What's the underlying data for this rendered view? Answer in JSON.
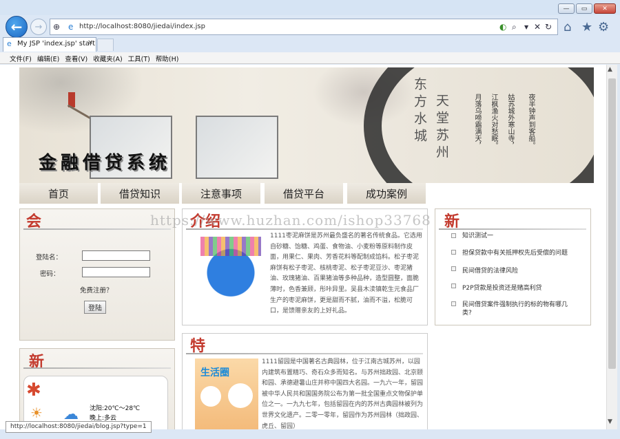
{
  "browser": {
    "url": "http://localhost:8080/jiedai/index.jsp",
    "tab_title": "My JSP 'index.jsp' startin...",
    "status_url": "http://localhost:8080/jiedai/blog.jsp?type=1",
    "menu": [
      "文件(F)",
      "编辑(E)",
      "查看(V)",
      "收藏夹(A)",
      "工具(T)",
      "帮助(H)"
    ]
  },
  "banner": {
    "logo": "金融借贷系统",
    "title_right": "天堂苏州",
    "title_left": "东方水城",
    "poem": [
      "夜半钟声到客船。",
      "姑苏城外寒山寺，",
      "江枫渔火对愁眠。",
      "月落乌啼霜满天，"
    ]
  },
  "nav": [
    "首页",
    "借贷知识",
    "注意事项",
    "借贷平台",
    "成功案例"
  ],
  "login": {
    "heading": "会",
    "username_label": "登陆名：",
    "password_label": "密码：",
    "register": "免费注册？",
    "submit": "登陆"
  },
  "weather_panel": {
    "heading": "新",
    "line1": "沈阳:20℃～28℃",
    "line2": "晚上:多云"
  },
  "watermark": "https://www.huzhan.com/ishop33768",
  "article1": {
    "heading": "介绍",
    "text": "1111枣泥麻饼是苏州最负盛名的著名传统食品。它选用自砂糖、饴糖、鸡蛋、食物油、小麦粉等原料制作皮面，用果仁、果肉、芳香花料等配制成馅料。松子枣泥麻饼有松子枣泥、核桃枣泥、松子枣泥豆沙、枣泥猪油、玫瑰猪油、百果猪油等多种品种，造型圆整，面脆薄时，色香兼顾，彤咔异里。吴县木渎镇乾生元食品厂生产的枣泥麻饼，更是甜而不腻，油而不溢，松脆可口，是馈赠亲友的上好礼品。"
  },
  "article2": {
    "heading": "特",
    "text": "1111留园是中国著名古典园林，位于江南古城苏州，以园内建筑布置精巧、奇石众多而知名。与苏州拙政园、北京颐和园、承德避暑山庄并称中国四大名园。一九六一年，留园被中华人民共和国国务院公布为第一批全国重点文物保护单位之一。一九九七年，包括留园在内的苏州古典园林被列为世界文化遗产。二零一零年，留园作为苏州园林（拙政园、虎丘、留园）"
  },
  "news": {
    "heading": "新",
    "items": [
      "知识测试一",
      "担保贷款中有关抵押权先后受偿的问题",
      "民间借贷的法律风险",
      "P2P贷款是投资还是赌高利贷",
      "民间借贷案件强制执行的标的物有哪几类?"
    ]
  },
  "colors": {
    "accent_red": "#c33a2e",
    "ie_blue": "#1b66c2"
  }
}
